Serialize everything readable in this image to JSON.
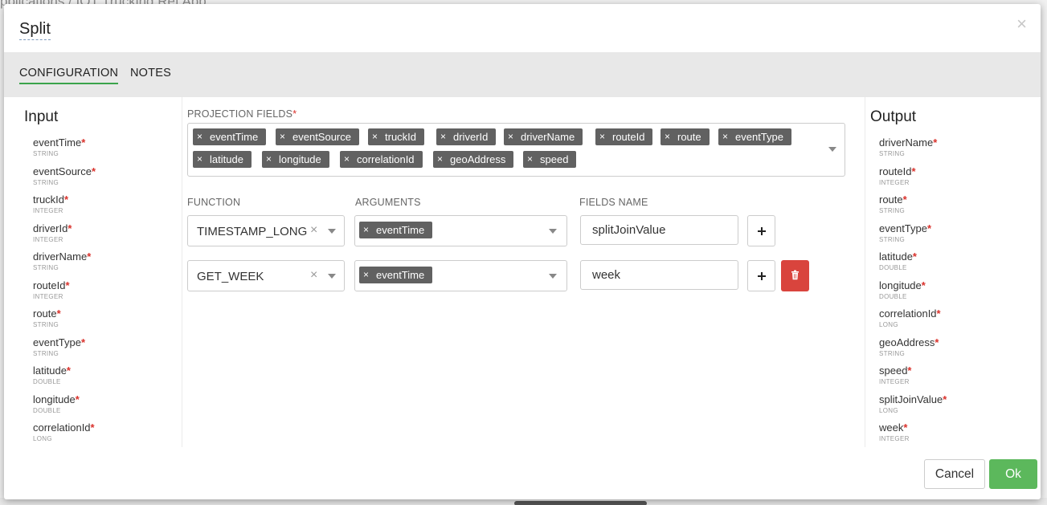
{
  "background": {
    "title": "pplications / IOT Trucking Ref App"
  },
  "modal": {
    "title": "Split",
    "close_glyph": "×"
  },
  "tabs": [
    {
      "label": "CONFIGURATION",
      "active": true
    },
    {
      "label": "NOTES",
      "active": false
    }
  ],
  "input": {
    "heading": "Input",
    "fields": [
      {
        "name": "eventTime",
        "type": "STRING"
      },
      {
        "name": "eventSource",
        "type": "STRING"
      },
      {
        "name": "truckId",
        "type": "INTEGER"
      },
      {
        "name": "driverId",
        "type": "INTEGER"
      },
      {
        "name": "driverName",
        "type": "STRING"
      },
      {
        "name": "routeId",
        "type": "INTEGER"
      },
      {
        "name": "route",
        "type": "STRING"
      },
      {
        "name": "eventType",
        "type": "STRING"
      },
      {
        "name": "latitude",
        "type": "DOUBLE"
      },
      {
        "name": "longitude",
        "type": "DOUBLE"
      },
      {
        "name": "correlationId",
        "type": "LONG"
      }
    ]
  },
  "output": {
    "heading": "Output",
    "fields": [
      {
        "name": "driverName",
        "type": "STRING"
      },
      {
        "name": "routeId",
        "type": "INTEGER"
      },
      {
        "name": "route",
        "type": "STRING"
      },
      {
        "name": "eventType",
        "type": "STRING"
      },
      {
        "name": "latitude",
        "type": "DOUBLE"
      },
      {
        "name": "longitude",
        "type": "DOUBLE"
      },
      {
        "name": "correlationId",
        "type": "LONG"
      },
      {
        "name": "geoAddress",
        "type": "STRING"
      },
      {
        "name": "speed",
        "type": "INTEGER"
      },
      {
        "name": "splitJoinValue",
        "type": "LONG"
      },
      {
        "name": "week",
        "type": "INTEGER"
      }
    ]
  },
  "projection": {
    "label": "PROJECTION FIELDS",
    "required_mark": "*",
    "chips": [
      "eventTime",
      "eventSource",
      "truckId",
      "driverId",
      "driverName",
      "routeId",
      "route",
      "eventType",
      "latitude",
      "longitude",
      "correlationId",
      "geoAddress",
      "speed"
    ]
  },
  "columns": {
    "function": "FUNCTION",
    "arguments": "ARGUMENTS",
    "fields_name": "FIELDS NAME"
  },
  "rows": [
    {
      "function": "TIMESTAMP_LONG",
      "argument": "eventTime",
      "field_name": "splitJoinValue",
      "deletable": false
    },
    {
      "function": "GET_WEEK",
      "argument": "eventTime",
      "field_name": "week",
      "deletable": true
    }
  ],
  "footer": {
    "cancel": "Cancel",
    "ok": "Ok"
  },
  "colors": {
    "ok_green": "#5cb85c",
    "delete_red": "#d9443d",
    "chip_gray": "#616161",
    "required_red": "#d9312b",
    "tab_underline": "#3ba44b"
  }
}
